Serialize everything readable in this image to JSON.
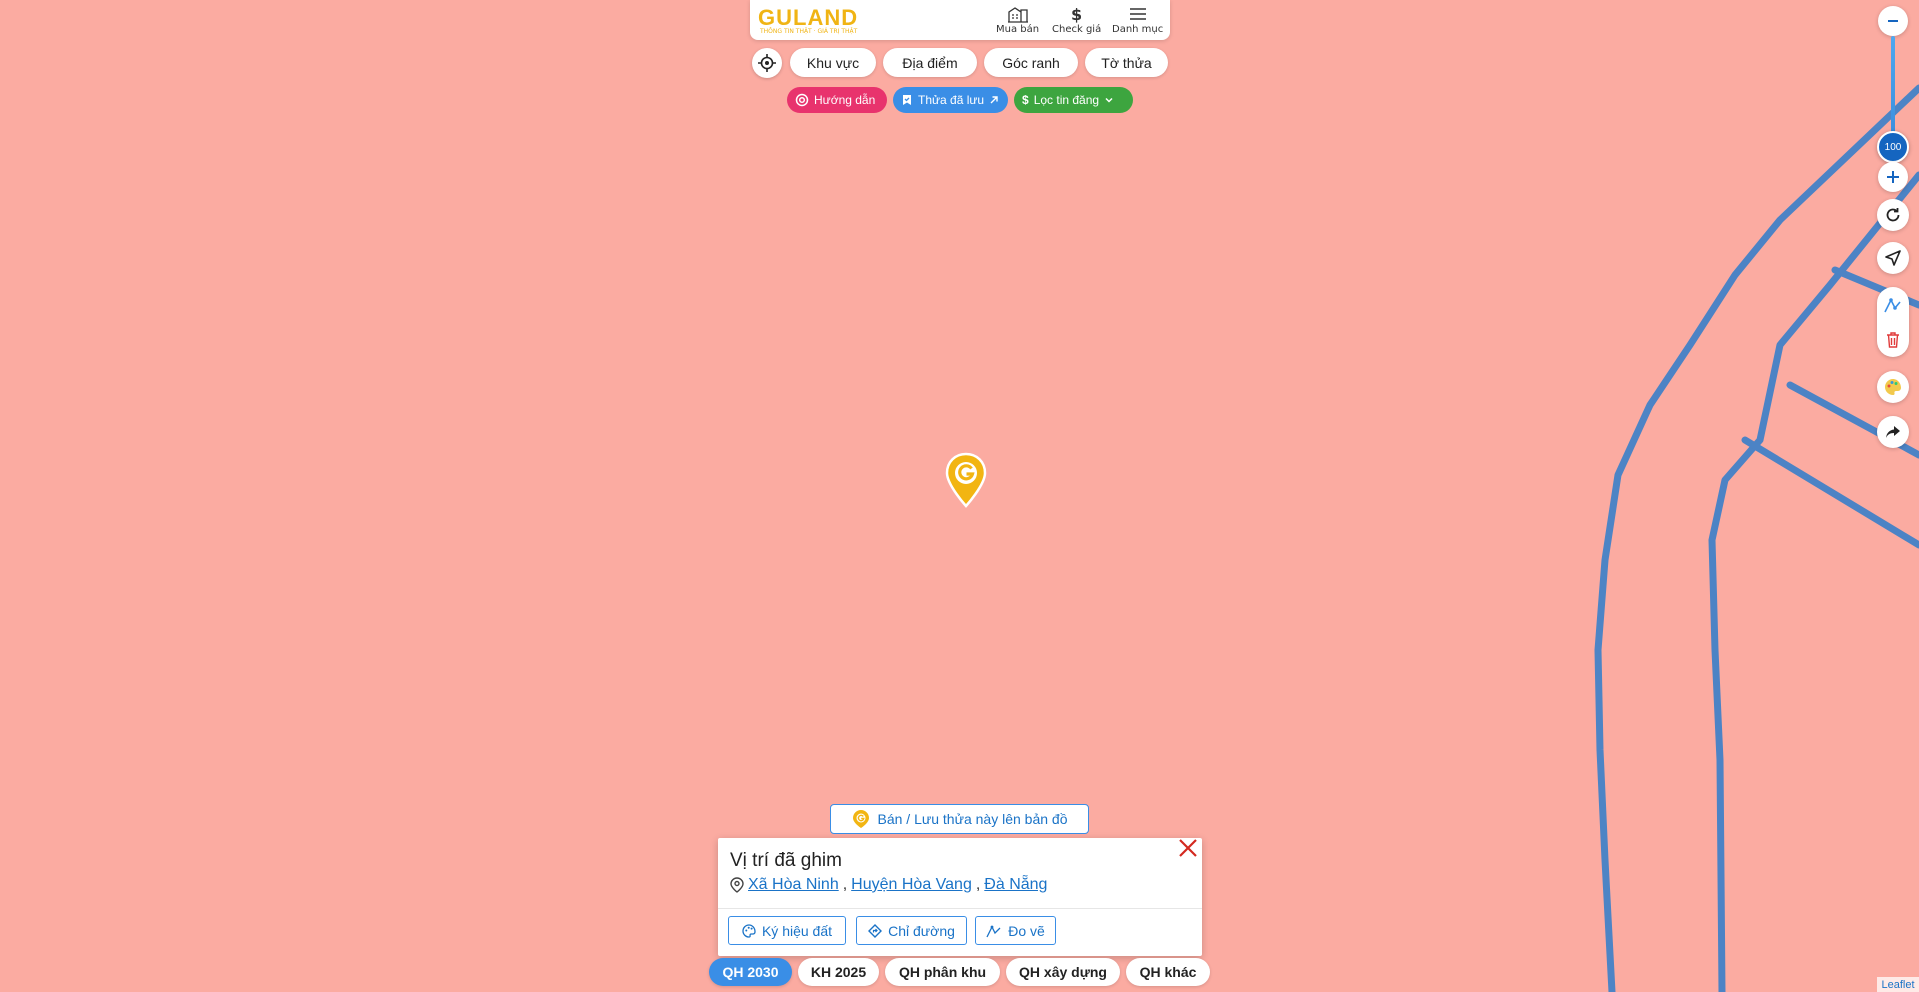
{
  "header": {
    "logo_text": "GULAND",
    "logo_tagline": "THÔNG TIN THẬT · GIÁ TRỊ THẬT",
    "nav": [
      {
        "label": "Mua bán",
        "icon": "buildings-icon"
      },
      {
        "label": "Check giá",
        "icon": "dollar-icon"
      },
      {
        "label": "Danh mục",
        "icon": "menu-icon"
      }
    ]
  },
  "toolbar": {
    "tabs": [
      "Khu vực",
      "Địa điểm",
      "Góc ranh",
      "Tờ thửa"
    ]
  },
  "chips": {
    "guide": "Hướng dẫn",
    "saved": "Thửa đã lưu",
    "filter": "Lọc tin đăng"
  },
  "zoom": {
    "level": "100",
    "fraction": 0.23
  },
  "popup": {
    "sell_button": "Bán / Lưu thửa này lên bản đồ",
    "title": "Vị trí đã ghim",
    "address": {
      "commune": "Xã Hòa Ninh",
      "district": "Huyện Hòa Vang",
      "city": "Đà Nẵng",
      "separator": ","
    },
    "actions": [
      "Ký hiệu đất",
      "Chỉ đường",
      "Đo vẽ"
    ]
  },
  "plan_tabs": {
    "items": [
      "QH 2030",
      "KH 2025",
      "QH phân khu",
      "QH xây dựng",
      "QH khác"
    ],
    "active_index": 0
  },
  "attribution": "Leaflet",
  "colors": {
    "map_background": "#fbaba1",
    "road": "#3a7fc9",
    "accent": "#3a8ee6",
    "guide_chip": "#e8336d",
    "saved_chip": "#3a8ee6",
    "filter_chip": "#3da53f",
    "brand": "#f0b414"
  }
}
